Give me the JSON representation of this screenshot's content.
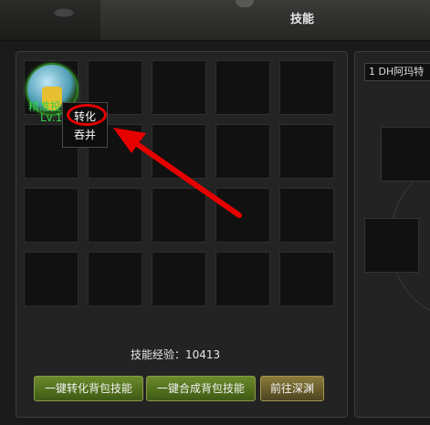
{
  "window": {
    "title": "技能"
  },
  "skill": {
    "name": "精准投",
    "level": "Lv.1"
  },
  "context_menu": {
    "items": [
      {
        "label": "转化"
      },
      {
        "label": "吞并"
      }
    ]
  },
  "character": {
    "name": "1 DH阿玛特"
  },
  "skill_exp": {
    "text": "技能经验：10413"
  },
  "buttons": {
    "convert_all": "一键转化背包技能",
    "merge_all": "一键合成背包技能",
    "go_deep": "前往深渊"
  },
  "annotation": {
    "color": "#e60000"
  }
}
